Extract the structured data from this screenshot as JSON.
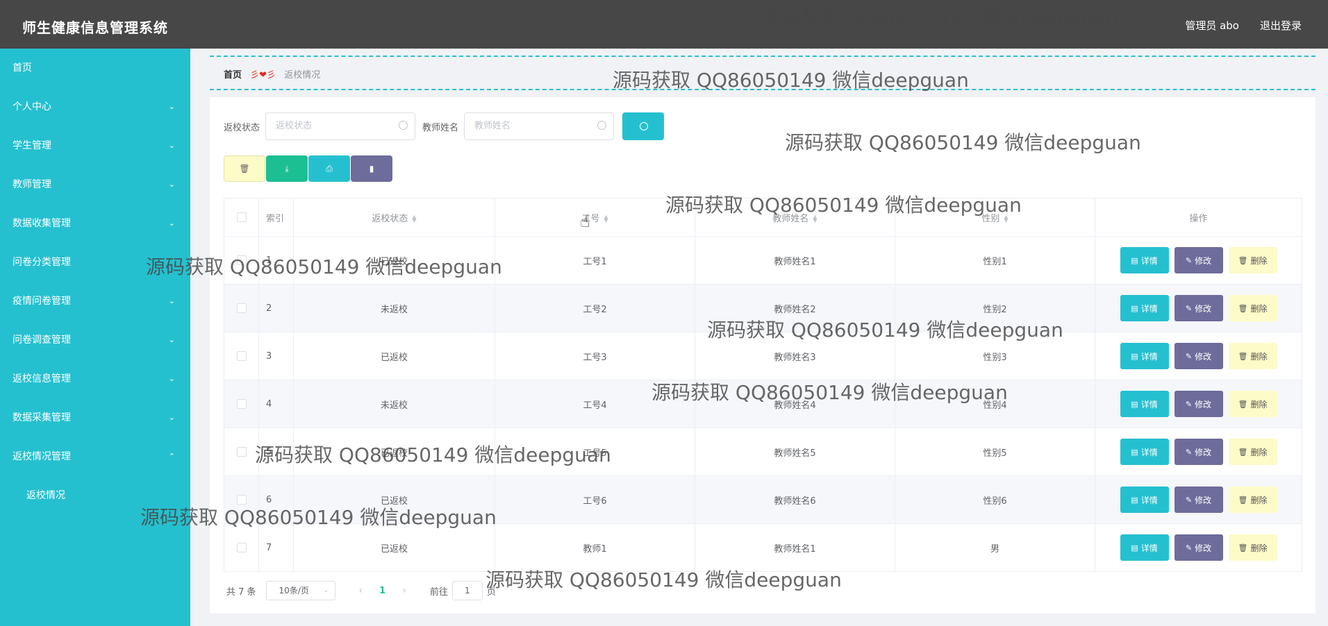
{
  "app": {
    "title": "师生健康信息管理系统",
    "user": "管理员 abo",
    "logout": "退出登录"
  },
  "sidebar": {
    "items": [
      {
        "label": "首页",
        "chev": ""
      },
      {
        "label": "个人中心",
        "chev": "⌄"
      },
      {
        "label": "学生管理",
        "chev": "⌄"
      },
      {
        "label": "教师管理",
        "chev": "⌄"
      },
      {
        "label": "数据收集管理",
        "chev": "⌄"
      },
      {
        "label": "问卷分类管理",
        "chev": ""
      },
      {
        "label": "疫情问卷管理",
        "chev": "⌄"
      },
      {
        "label": "问卷调查管理",
        "chev": "⌄"
      },
      {
        "label": "返校信息管理",
        "chev": "⌄"
      },
      {
        "label": "数据采集管理",
        "chev": "⌄"
      },
      {
        "label": "返校情况管理",
        "chev": "⌃"
      }
    ],
    "sub_item": "返校情况"
  },
  "breadcrumb": {
    "home": "首页",
    "separator": "彡❤彡",
    "current": "返校情况"
  },
  "filter": {
    "status_label": "返校状态",
    "status_placeholder": "返校状态",
    "name_label": "教师姓名",
    "name_placeholder": "教师姓名"
  },
  "actions": {
    "delete": "🗑",
    "export": "⤓",
    "print": "⎙",
    "chart": "▮"
  },
  "table": {
    "headers": [
      "索引",
      "返校状态",
      "工号",
      "教师姓名",
      "性别",
      "操作"
    ],
    "rows": [
      {
        "index": "1",
        "status": "已返校",
        "job": "工号1",
        "name": "教师姓名1",
        "gender": "性别1"
      },
      {
        "index": "2",
        "status": "未返校",
        "job": "工号2",
        "name": "教师姓名2",
        "gender": "性别2"
      },
      {
        "index": "3",
        "status": "已返校",
        "job": "工号3",
        "name": "教师姓名3",
        "gender": "性别3"
      },
      {
        "index": "4",
        "status": "未返校",
        "job": "工号4",
        "name": "教师姓名4",
        "gender": "性别4"
      },
      {
        "index": "5",
        "status": "已返校",
        "job": "工号5",
        "name": "教师姓名5",
        "gender": "性别5"
      },
      {
        "index": "6",
        "status": "已返校",
        "job": "工号6",
        "name": "教师姓名6",
        "gender": "性别6"
      },
      {
        "index": "7",
        "status": "已返校",
        "job": "教师1",
        "name": "教师姓名1",
        "gender": "男"
      }
    ],
    "ops": {
      "detail": "详情",
      "edit": "修改",
      "remove": "删除"
    }
  },
  "pager": {
    "total": "共 7 条",
    "page_size": "10条/页",
    "current": "1",
    "goto": "前往",
    "goto_value": "1",
    "page_suffix": "页"
  },
  "watermark": "源码获取 QQ86050149 微信deepguan"
}
